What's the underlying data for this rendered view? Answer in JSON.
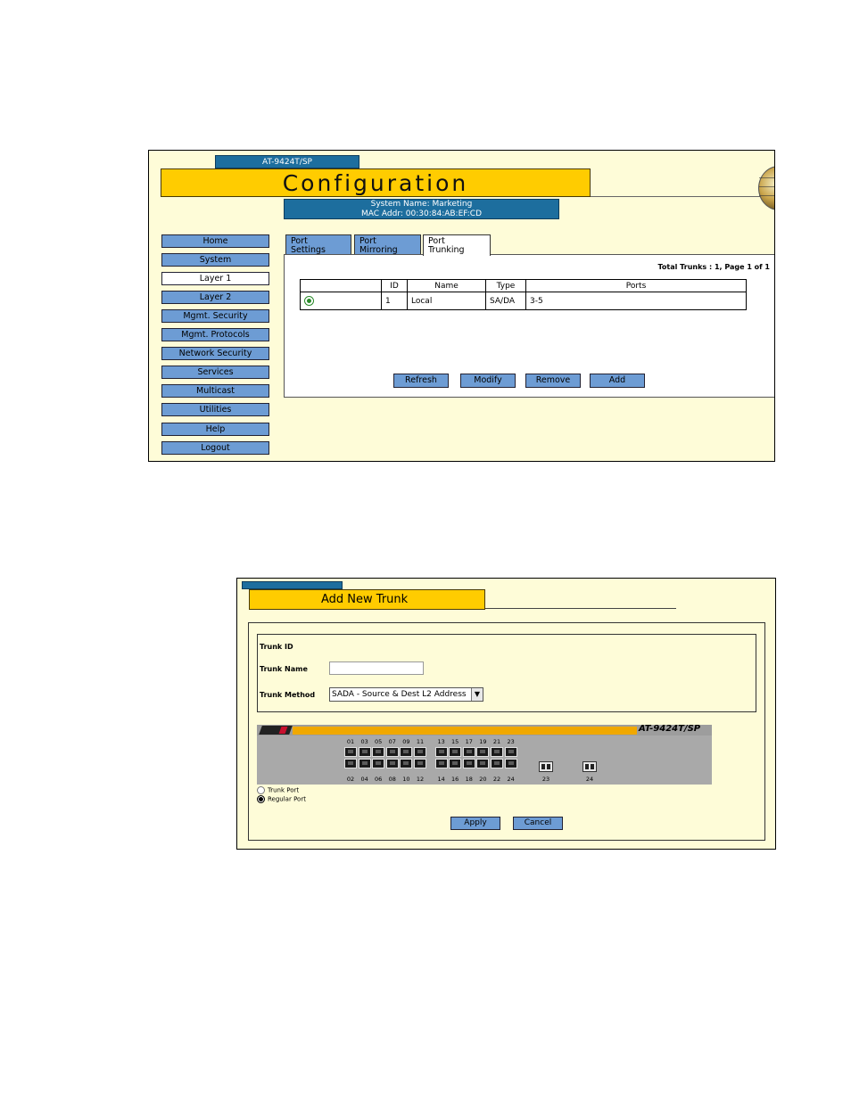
{
  "config": {
    "model_tab": "AT-9424T/SP",
    "title": "Configuration",
    "system_name": "System Name: Marketing",
    "mac_addr": "MAC Addr: 00:30:84:AB:EF:CD",
    "nav": [
      "Home",
      "System",
      "Layer 1",
      "Layer 2",
      "Mgmt. Security",
      "Mgmt. Protocols",
      "Network Security",
      "Services",
      "Multicast",
      "Utilities",
      "Help",
      "Logout"
    ],
    "nav_active": "Layer 1",
    "tabs": [
      {
        "line1": "Port",
        "line2": "Settings"
      },
      {
        "line1": "Port",
        "line2": "Mirroring"
      },
      {
        "line1": "Port",
        "line2": "Trunking"
      }
    ],
    "active_tab": "Port Trunking",
    "total_trunks": "Total Trunks : 1, Page 1 of 1",
    "table": {
      "headers": [
        "",
        "ID",
        "Name",
        "Type",
        "Ports"
      ],
      "rows": [
        {
          "id": "1",
          "name": "Local",
          "type": "SA/DA",
          "ports": "3-5",
          "selected": true
        }
      ]
    },
    "buttons": {
      "refresh": "Refresh",
      "modify": "Modify",
      "remove": "Remove",
      "add": "Add"
    }
  },
  "add_trunk": {
    "title": "Add New Trunk",
    "fields": {
      "trunk_id_label": "Trunk ID",
      "trunk_name_label": "Trunk Name",
      "trunk_name_value": "",
      "trunk_method_label": "Trunk Method",
      "trunk_method_value": "SADA - Source & Dest L2 Address"
    },
    "switch": {
      "model": "AT-9424T/SP",
      "top_port_numbers": [
        "01",
        "03",
        "05",
        "07",
        "09",
        "11",
        "13",
        "15",
        "17",
        "19",
        "21",
        "23"
      ],
      "bottom_port_numbers": [
        "02",
        "04",
        "06",
        "08",
        "10",
        "12",
        "14",
        "16",
        "18",
        "20",
        "22",
        "24"
      ],
      "sfp_numbers": [
        "23",
        "24"
      ]
    },
    "legend": {
      "trunk_port": "Trunk Port",
      "regular_port": "Regular Port",
      "selected": "Regular Port"
    },
    "buttons": {
      "apply": "Apply",
      "cancel": "Cancel"
    }
  },
  "colors": {
    "panel_bg": "#fefcd8",
    "title_yellow": "#ffcc00",
    "header_blue": "#1d6e9e",
    "button_blue": "#6d9cd4",
    "stripe_orange": "#f0a800",
    "switch_gray": "#a9a9a9"
  }
}
